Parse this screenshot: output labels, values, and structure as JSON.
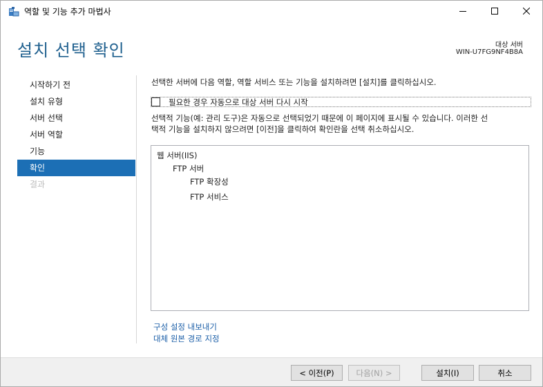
{
  "window": {
    "title": "역할 및 기능 추가 마법사"
  },
  "header": {
    "page_title": "설치 선택 확인",
    "destination_label": "대상 서버",
    "destination_server": "WIN-U7FG9NF4B8A"
  },
  "nav": {
    "items": [
      {
        "label": "시작하기 전",
        "state": "normal"
      },
      {
        "label": "설치 유형",
        "state": "normal"
      },
      {
        "label": "서버 선택",
        "state": "normal"
      },
      {
        "label": "서버 역할",
        "state": "normal"
      },
      {
        "label": "기능",
        "state": "normal"
      },
      {
        "label": "확인",
        "state": "active"
      },
      {
        "label": "결과",
        "state": "disabled"
      }
    ]
  },
  "content": {
    "intro": "선택한 서버에 다음 역할, 역할 서비스 또는 기능을 설치하려면 [설치]를 클릭하십시오.",
    "restart_checkbox": {
      "label": "필요한 경우 자동으로 대상 서버 다시 시작",
      "checked": false
    },
    "note_line1": "선택적 기능(예: 관리 도구)은 자동으로 선택되었기 때문에 이 페이지에 표시될 수 있습니다. 이러한 선",
    "note_line2": "택적 기능을 설치하지 않으려면 [이전]을 클릭하여 확인란을 선택 취소하십시오.",
    "features": [
      "웹 서버(IIS)",
      "FTP 서버",
      "FTP 확장성",
      "FTP 서비스"
    ],
    "links": {
      "export": "구성 설정 내보내기",
      "alternate_source": "대체 원본 경로 지정"
    }
  },
  "footer": {
    "previous_label": "< 이전(P)",
    "next_label": "다음(N) >",
    "install_label": "설치(I)",
    "cancel_label": "취소"
  },
  "colors": {
    "accent": "#1c6fb5",
    "title": "#1e5f8e",
    "link": "#1c5fa8"
  }
}
